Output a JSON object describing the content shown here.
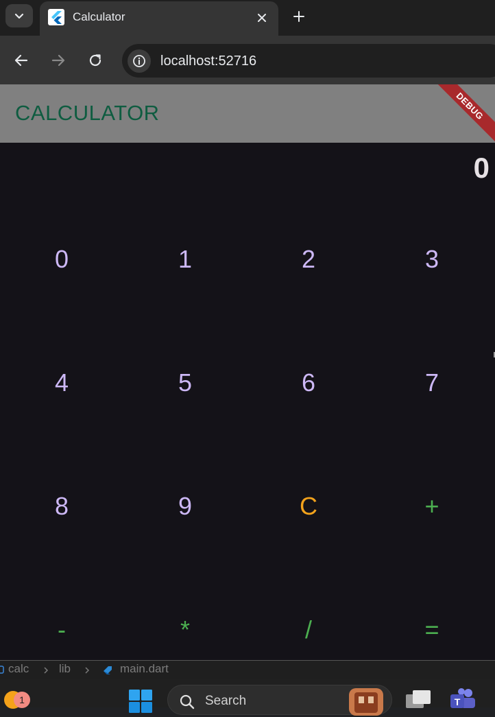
{
  "browser": {
    "tab": {
      "title": "Calculator",
      "favicon": "flutter-icon"
    },
    "address_bar": {
      "url": "localhost:52716"
    },
    "icons": {
      "tab_search": "chevron-down-icon",
      "close": "close-icon",
      "new_tab": "plus-icon",
      "back": "arrow-left-icon",
      "forward": "arrow-right-icon",
      "reload": "reload-icon",
      "site_info": "info-icon"
    }
  },
  "app": {
    "title": "CALCULATOR",
    "debug_banner": "DEBUG",
    "display_value": "0",
    "keys": [
      "0",
      "1",
      "2",
      "3",
      "4",
      "5",
      "6",
      "7",
      "8",
      "9",
      "C",
      "+",
      "-",
      "*",
      "/",
      "="
    ],
    "colors": {
      "appbar_bg": "#808080",
      "title": "#0e5c40",
      "background": "#141218",
      "number_key": "#cdb8f6",
      "clear_key": "#f2a21c",
      "operator_key": "#4caf50",
      "debug_banner": "#a8292c"
    }
  },
  "ide": {
    "breadcrumb": [
      "calc",
      "lib",
      "main.dart"
    ]
  },
  "taskbar": {
    "notification_count": "1",
    "search_label": "Search"
  }
}
